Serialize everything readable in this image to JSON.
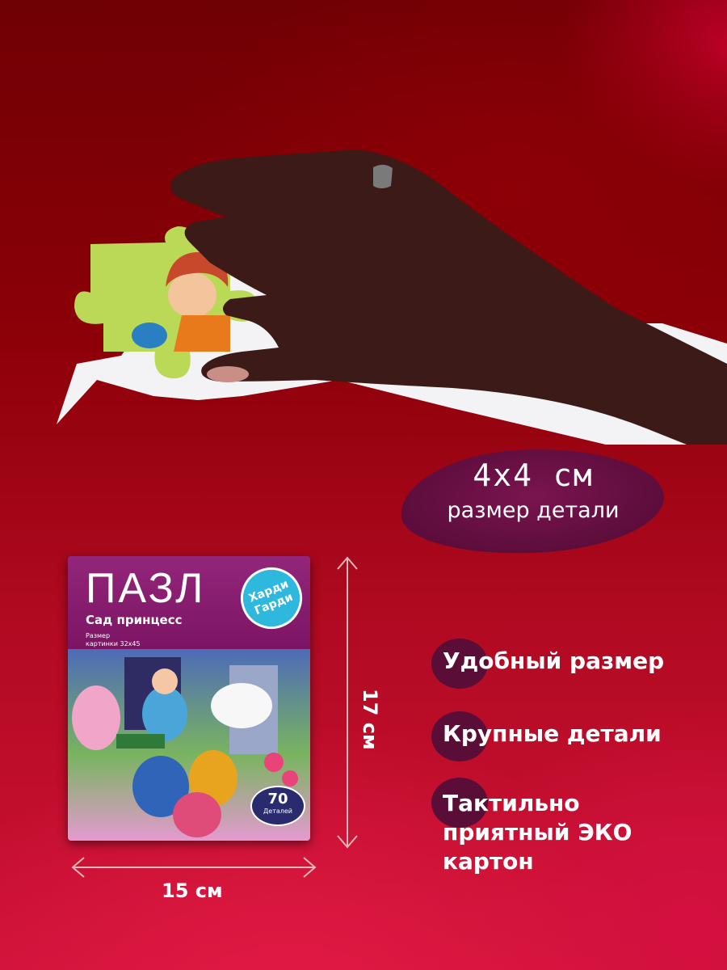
{
  "badge": {
    "value": "4x4 см",
    "label": "размер детали"
  },
  "features": [
    {
      "text": "Удобный размер"
    },
    {
      "text": "Крупные детали"
    },
    {
      "text": "Тактильно приятный ЭКО картон"
    }
  ],
  "dimensions": {
    "height": "17 см",
    "width": "15 см"
  },
  "box": {
    "title": "ПАЗЛ",
    "subtitle": "Сад принцесс",
    "size_note": "Размер картинки 32x45 см",
    "brand": "Харди Гарди",
    "pieces_count": "70",
    "pieces_label": "Деталей"
  },
  "colors": {
    "accent": "#5d0d3c",
    "background": "#a30c1a",
    "box": "#8a1b6b"
  }
}
